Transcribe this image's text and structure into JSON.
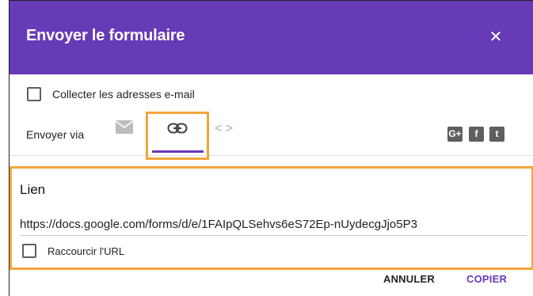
{
  "dialog": {
    "title": "Envoyer le formulaire",
    "close_icon": "close-icon"
  },
  "collect": {
    "label": "Collecter les adresses e-mail",
    "checked": false
  },
  "send_via": {
    "label": "Envoyer via",
    "tabs": [
      {
        "icon": "email-icon",
        "active": false
      },
      {
        "icon": "link-icon",
        "active": true
      },
      {
        "icon": "embed-icon",
        "active": false
      }
    ],
    "social": [
      {
        "icon": "google-plus-icon",
        "glyph": "G+"
      },
      {
        "icon": "facebook-icon",
        "glyph": "f"
      },
      {
        "icon": "twitter-icon",
        "glyph": "t"
      }
    ]
  },
  "link": {
    "heading": "Lien",
    "url": "https://docs.google.com/forms/d/e/1FAIpQLSehvs6eS72Ep-nUydecgJjo5P3",
    "shorten_label": "Raccourcir l'URL",
    "shorten_checked": false
  },
  "footer": {
    "cancel_label": "ANNULER",
    "copy_label": "COPIER"
  },
  "colors": {
    "header": "#673ab7",
    "highlight": "#f2a53a",
    "accent": "#673ab7"
  }
}
